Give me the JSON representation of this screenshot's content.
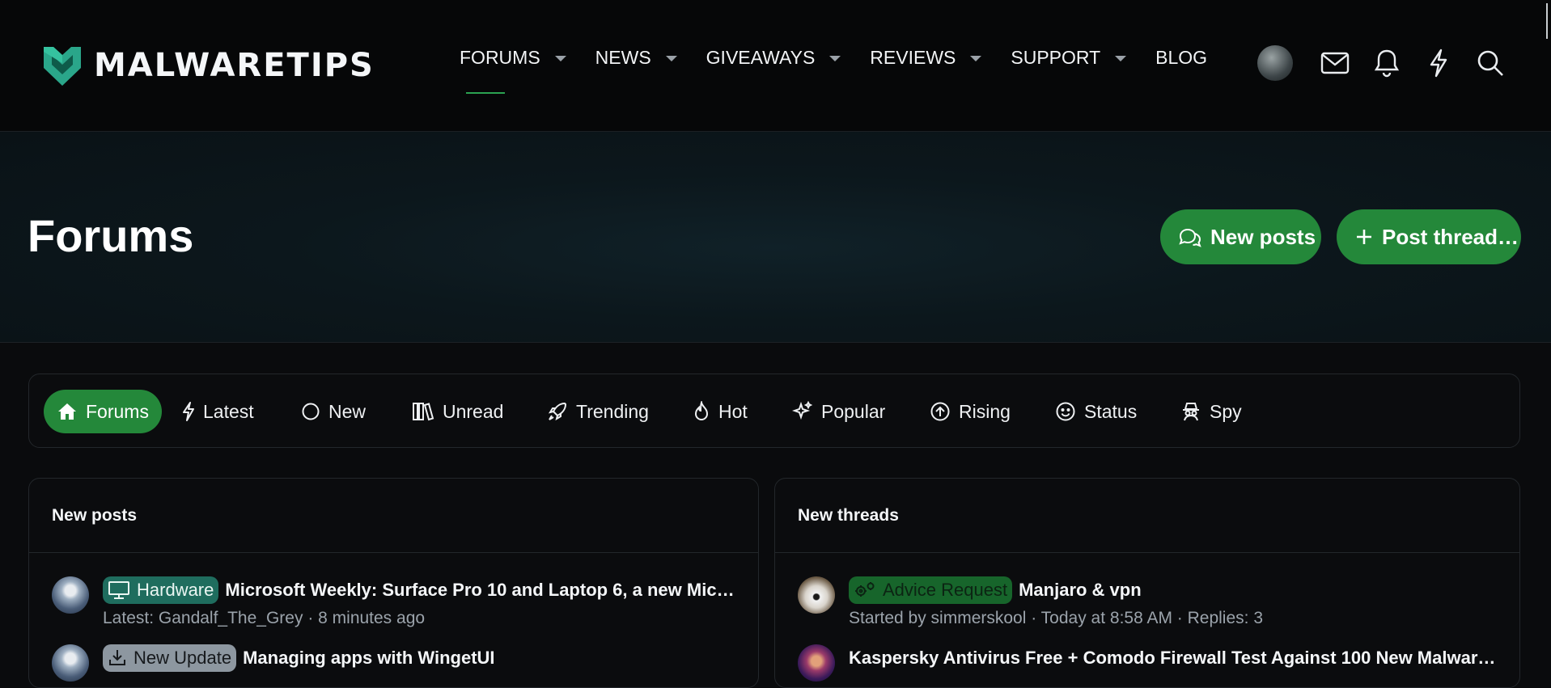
{
  "brand": {
    "name": "MALWARETIPS",
    "accent": "#24883a",
    "logo_color": "#2aa68a"
  },
  "nav": [
    {
      "label": "FORUMS",
      "dropdown": true,
      "active": true
    },
    {
      "label": "NEWS",
      "dropdown": true
    },
    {
      "label": "GIVEAWAYS",
      "dropdown": true
    },
    {
      "label": "REVIEWS",
      "dropdown": true
    },
    {
      "label": "SUPPORT",
      "dropdown": true
    },
    {
      "label": "BLOG",
      "dropdown": false
    }
  ],
  "header_icons": [
    "avatar",
    "envelope-icon",
    "bell-icon",
    "lightning-icon",
    "search-icon"
  ],
  "hero": {
    "title": "Forums",
    "new_posts_button": "New posts",
    "post_thread_button": "Post thread…"
  },
  "tabs": [
    {
      "label": "Forums",
      "icon": "home-icon",
      "active": true
    },
    {
      "label": "Latest",
      "icon": "lightning-icon"
    },
    {
      "label": "New",
      "icon": "circle-icon"
    },
    {
      "label": "Unread",
      "icon": "books-icon"
    },
    {
      "label": "Trending",
      "icon": "rocket-icon"
    },
    {
      "label": "Hot",
      "icon": "flame-icon"
    },
    {
      "label": "Popular",
      "icon": "sparkle-icon"
    },
    {
      "label": "Rising",
      "icon": "arrow-up-circle-icon"
    },
    {
      "label": "Status",
      "icon": "smile-icon"
    },
    {
      "label": "Spy",
      "icon": "spy-icon"
    }
  ],
  "new_posts": {
    "heading": "New posts",
    "items": [
      {
        "label": "Hardware",
        "label_icon": "monitor-icon",
        "title": "Microsoft Weekly: Surface Pro 10 and Laptop 6, a new Mic…",
        "meta": "Latest: Gandalf_The_Grey · 8 minutes ago"
      },
      {
        "label": "New Update",
        "label_icon": "download-icon",
        "title": "Managing apps with WingetUI",
        "meta": ""
      }
    ]
  },
  "new_threads": {
    "heading": "New threads",
    "items": [
      {
        "label": "Advice Request",
        "label_icon": "gears-icon",
        "title": "Manjaro & vpn",
        "meta": "Started by simmerskool · Today at 8:58 AM · Replies: 3"
      },
      {
        "label": "",
        "title": "Kaspersky Antivirus Free + Comodo Firewall Test Against 100 New Malware…",
        "meta": ""
      }
    ]
  }
}
